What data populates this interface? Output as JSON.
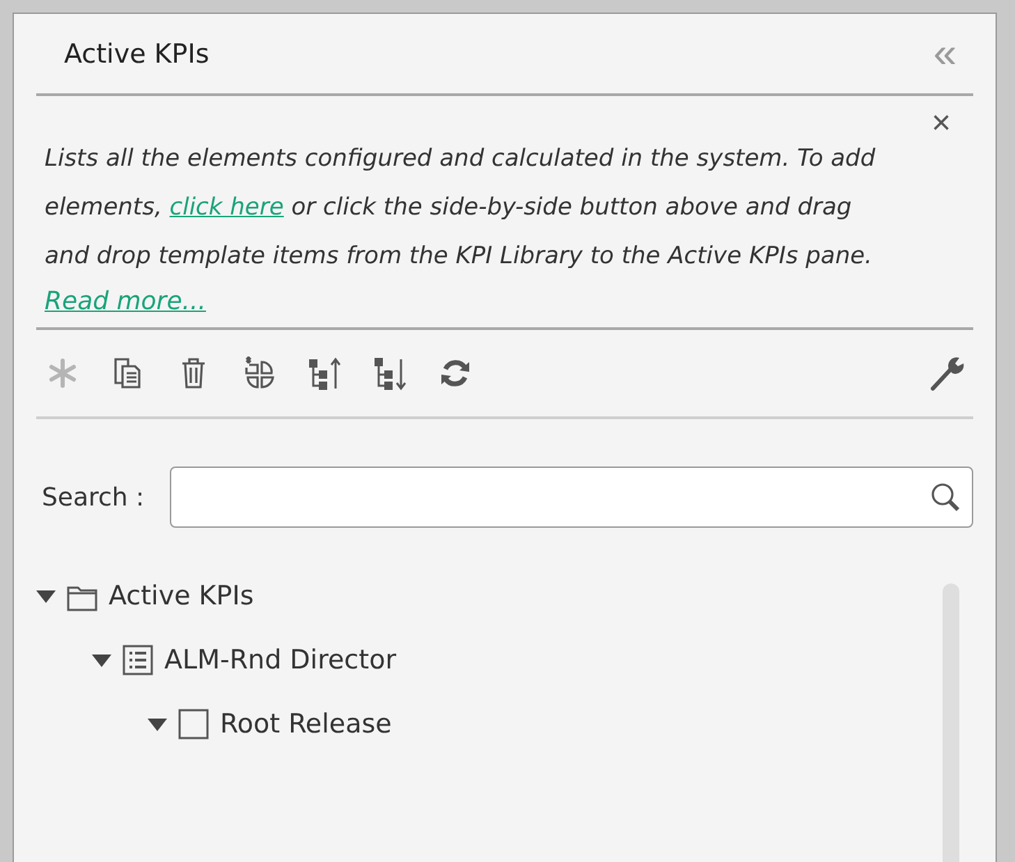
{
  "pane": {
    "title": "Active KPIs",
    "collapse_icon": "«"
  },
  "info": {
    "text_before": "Lists all the elements configured and calculated in the system. To add elements,",
    "link": "click here",
    "text_after": "or click the side-by-side button above and drag and drop template items from the KPI Library to the Active KPIs pane.",
    "read_more": "Read more...",
    "close": "×"
  },
  "toolbar": [
    {
      "kind": "new",
      "disabled": true
    },
    {
      "kind": "copy",
      "disabled": false
    },
    {
      "kind": "delete",
      "disabled": false
    },
    {
      "kind": "side-by-side",
      "disabled": false
    },
    {
      "kind": "move-up",
      "disabled": false
    },
    {
      "kind": "move-down",
      "disabled": false
    },
    {
      "kind": "refresh",
      "disabled": false
    }
  ],
  "search": {
    "label": "Search :"
  },
  "tree": [
    {
      "label": "Active KPIs",
      "kind": "folder",
      "expanded": true,
      "children": [
        {
          "label": "ALM-Rnd Director",
          "kind": "list",
          "expanded": true,
          "children": [
            {
              "label": "Root Release",
              "kind": "box",
              "expanded": true
            }
          ]
        }
      ]
    }
  ]
}
